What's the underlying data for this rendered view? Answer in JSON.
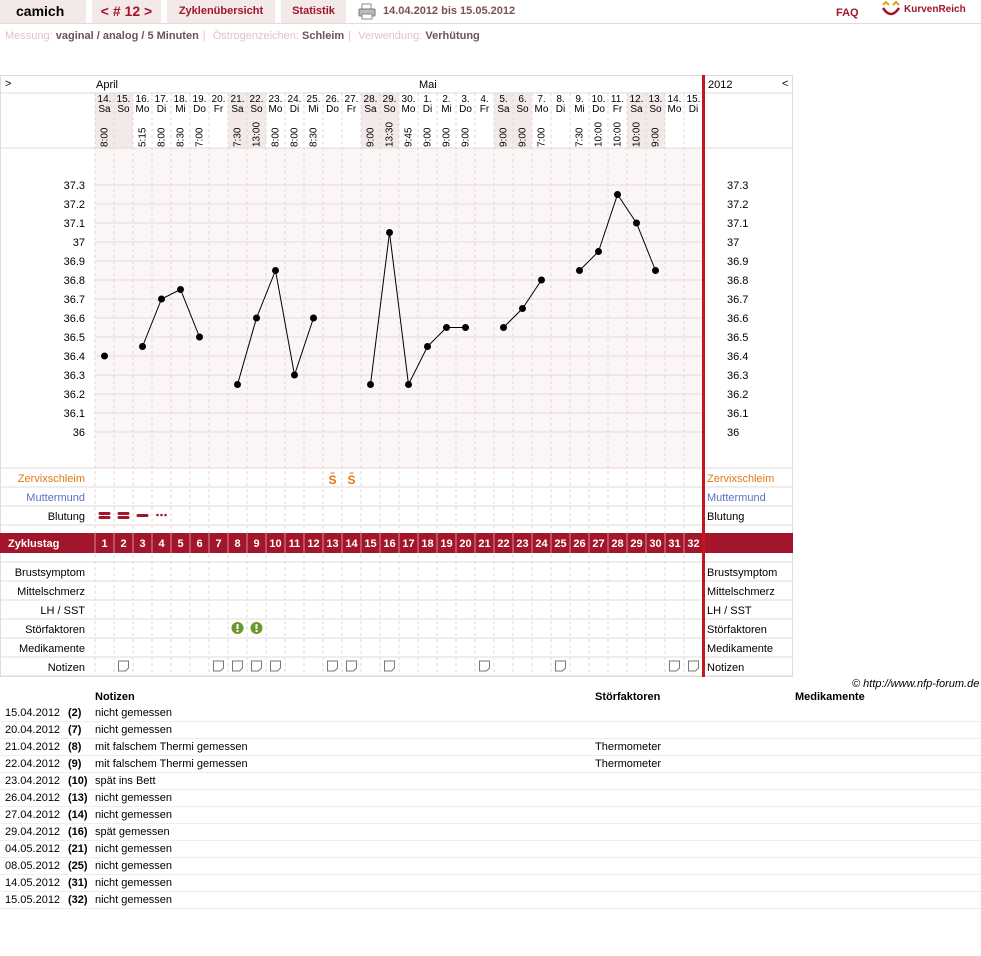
{
  "nav": {
    "user": "camich",
    "cycle": "< # 12 >",
    "overview": "Zyklenübersicht",
    "stats": "Statistik",
    "daterange": "14.04.2012 bis 15.05.2012",
    "faq": "FAQ",
    "logo": "KurvenReich"
  },
  "meta": {
    "messung_label": "Messung:",
    "messung": "vaginal / analog / 5 Minuten",
    "oestro_label": "Östrogenzeichen:",
    "oestro": "Schleim",
    "verw_label": "Verwendung:",
    "verw": "Verhütung"
  },
  "chart": {
    "nav_left": ">",
    "nav_right": "<",
    "month1": "April",
    "month2": "Mai",
    "year": "2012",
    "dates": [
      "14.",
      "15.",
      "16.",
      "17.",
      "18.",
      "19.",
      "20.",
      "21.",
      "22.",
      "23.",
      "24.",
      "25.",
      "26.",
      "27.",
      "28.",
      "29.",
      "30.",
      "1.",
      "2.",
      "3.",
      "4.",
      "5.",
      "6.",
      "7.",
      "8.",
      "9.",
      "10.",
      "11.",
      "12.",
      "13.",
      "14.",
      "15."
    ],
    "weekdays": [
      "Sa",
      "So",
      "Mo",
      "Di",
      "Mi",
      "Do",
      "Fr",
      "Sa",
      "So",
      "Mo",
      "Di",
      "Mi",
      "Do",
      "Fr",
      "Sa",
      "So",
      "Mo",
      "Di",
      "Mi",
      "Do",
      "Fr",
      "Sa",
      "So",
      "Mo",
      "Di",
      "Mi",
      "Do",
      "Fr",
      "Sa",
      "So",
      "Mo",
      "Di"
    ],
    "times": [
      "8:00",
      "",
      "5:15",
      "8:00",
      "8:30",
      "7:00",
      "",
      "7:30",
      "13:00",
      "8:00",
      "8:00",
      "8:30",
      "",
      "",
      "9:00",
      "13:30",
      "9:45",
      "9:00",
      "9:00",
      "9:00",
      "",
      "9:00",
      "9:00",
      "7:00",
      "",
      "7:30",
      "10:00",
      "10:00",
      "10:00",
      "9:00",
      "",
      ""
    ],
    "y_ticks": [
      "37.3",
      "37.2",
      "37.1",
      "37",
      "36.9",
      "36.8",
      "36.7",
      "36.6",
      "36.5",
      "36.4",
      "36.3",
      "36.2",
      "36.1",
      "36"
    ],
    "row_labels_left": [
      "Zervixschleim",
      "Muttermund",
      "Blutung"
    ],
    "row_labels_right": [
      "Zervixschleim",
      "Muttermund",
      "Blutung"
    ],
    "zyklustag_label": "Zyklustag",
    "cycle_days": [
      "1",
      "2",
      "3",
      "4",
      "5",
      "6",
      "7",
      "8",
      "9",
      "10",
      "11",
      "12",
      "13",
      "14",
      "15",
      "16",
      "17",
      "18",
      "19",
      "20",
      "21",
      "22",
      "23",
      "24",
      "25",
      "26",
      "27",
      "28",
      "29",
      "30",
      "31",
      "32"
    ],
    "lower_rows": [
      "Brustsymptom",
      "Mittelschmerz",
      "LH / SST",
      "Störfaktoren",
      "Medikamente",
      "Notizen"
    ],
    "mucus_symbol": "S",
    "colors": {
      "accent": "#a3152a",
      "mucus": "#e07a10",
      "muttermund": "#5b6fc4",
      "weekend": "#f3e9e9",
      "ok": "#6a9a2a"
    }
  },
  "chart_data": {
    "type": "line",
    "x_dates": [
      "14.04.",
      "15.04.",
      "16.04.",
      "17.04.",
      "18.04.",
      "19.04.",
      "20.04.",
      "21.04.",
      "22.04.",
      "23.04.",
      "24.04.",
      "25.04.",
      "26.04.",
      "27.04.",
      "28.04.",
      "29.04.",
      "30.04.",
      "1.05.",
      "2.05.",
      "3.05.",
      "4.05.",
      "5.05.",
      "6.05.",
      "7.05.",
      "8.05.",
      "9.05.",
      "10.05.",
      "11.05.",
      "12.05.",
      "13.05.",
      "14.05.",
      "15.05."
    ],
    "temperatures": [
      36.4,
      null,
      36.45,
      36.7,
      36.75,
      36.5,
      null,
      36.25,
      36.6,
      36.85,
      36.3,
      36.6,
      null,
      null,
      36.25,
      37.05,
      36.25,
      36.45,
      36.55,
      36.55,
      null,
      36.55,
      36.65,
      36.8,
      null,
      36.85,
      36.95,
      37.25,
      37.1,
      36.85,
      null,
      null
    ],
    "ylim": [
      36.0,
      37.3
    ],
    "bleeding": [
      2,
      2,
      1,
      0.5,
      0,
      0,
      0,
      0,
      0,
      0,
      0,
      0,
      0,
      0,
      0,
      0,
      0,
      0,
      0,
      0,
      0,
      0,
      0,
      0,
      0,
      0,
      0,
      0,
      0,
      0,
      0,
      0
    ],
    "mucus_days": [
      13,
      14
    ],
    "disturbance_days": [
      8,
      9
    ],
    "note_days": [
      2,
      7,
      8,
      9,
      10,
      13,
      14,
      16,
      21,
      25,
      31,
      32
    ]
  },
  "notes": {
    "headers": {
      "notes": "Notizen",
      "stoer": "Störfaktoren",
      "medi": "Medikamente"
    },
    "rows": [
      {
        "date": "15.04.2012",
        "day": "(2)",
        "note": "nicht gemessen",
        "stoer": ""
      },
      {
        "date": "20.04.2012",
        "day": "(7)",
        "note": "nicht gemessen",
        "stoer": ""
      },
      {
        "date": "21.04.2012",
        "day": "(8)",
        "note": "mit falschem Thermi gemessen",
        "stoer": "Thermometer"
      },
      {
        "date": "22.04.2012",
        "day": "(9)",
        "note": "mit falschem Thermi gemessen",
        "stoer": "Thermometer"
      },
      {
        "date": "23.04.2012",
        "day": "(10)",
        "note": "spät ins Bett",
        "stoer": ""
      },
      {
        "date": "26.04.2012",
        "day": "(13)",
        "note": "nicht gemessen",
        "stoer": ""
      },
      {
        "date": "27.04.2012",
        "day": "(14)",
        "note": "nicht gemessen",
        "stoer": ""
      },
      {
        "date": "29.04.2012",
        "day": "(16)",
        "note": "spät gemessen",
        "stoer": ""
      },
      {
        "date": "04.05.2012",
        "day": "(21)",
        "note": "nicht gemessen",
        "stoer": ""
      },
      {
        "date": "08.05.2012",
        "day": "(25)",
        "note": "nicht gemessen",
        "stoer": ""
      },
      {
        "date": "14.05.2012",
        "day": "(31)",
        "note": "nicht gemessen",
        "stoer": ""
      },
      {
        "date": "15.05.2012",
        "day": "(32)",
        "note": "nicht gemessen",
        "stoer": ""
      }
    ]
  },
  "copyright": "© http://www.nfp-forum.de"
}
